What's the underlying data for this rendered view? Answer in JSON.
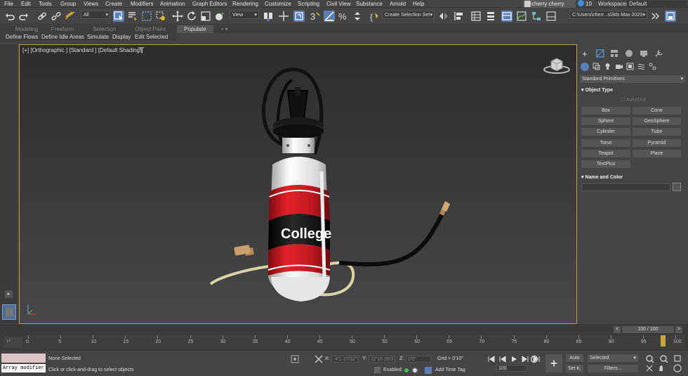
{
  "menu": [
    "File",
    "Edit",
    "Tools",
    "Group",
    "Views",
    "Create",
    "Modifiers",
    "Animation",
    "Graph Editors",
    "Rendering",
    "Customize",
    "Scripting",
    "Civil View",
    "Substance",
    "Arnold",
    "Help"
  ],
  "user": {
    "name": "cherry cherry"
  },
  "notifications": {
    "count": "10"
  },
  "workspaces": {
    "label": "Workspaces:",
    "value": "Default"
  },
  "toolbar": {
    "filter": "All",
    "ref_coord": "View",
    "selection_set": "Create Selection Set",
    "project_path": "C:\\Users\\cherr...s\\3ds Max 2023"
  },
  "ribbon": {
    "tabs": [
      "Modeling",
      "Freeform",
      "Selection",
      "Object Paint",
      "Populate"
    ],
    "active": "Populate",
    "sub_items": [
      "Define Flows",
      "Define Idle Areas",
      "Simulate",
      "Display",
      "Edit Selected"
    ]
  },
  "viewport": {
    "label": "[+] [Orthographic ] [Standard ] [Default Shading ]",
    "product_text": "College"
  },
  "command_panel": {
    "category": "Standard Primitives",
    "object_type_title": "Object Type",
    "autogrid": "AutoGrid",
    "buttons": [
      "Box",
      "Cone",
      "Sphere",
      "GeoSphere",
      "Cylinder",
      "Tube",
      "Torus",
      "Pyramid",
      "Teapot",
      "Plane",
      "TextPlus"
    ],
    "name_color_title": "Name and Color"
  },
  "timeline": {
    "frame_display": "100 / 100",
    "ticks": [
      "0",
      "5",
      "10",
      "15",
      "20",
      "25",
      "30",
      "35",
      "40",
      "45",
      "50",
      "55",
      "60",
      "65",
      "70",
      "75",
      "80",
      "85",
      "90",
      "95",
      "100"
    ]
  },
  "status": {
    "maxscript": "Array modifier",
    "selected": "None Selected",
    "prompt": "Click or click-and-drag to select objects",
    "x_label": "X:",
    "x_val": "-4'1 27/32\"",
    "y_label": "Y:",
    "y_val": "22'10 26/3",
    "z_label": "Z:",
    "z_val": "0'0\"",
    "grid": "Grid = 0'10\"",
    "enabled": "Enabled:",
    "add_time_tag": "Add Time Tag",
    "auto": "Auto",
    "set_key": "Set K.",
    "key_filter": "Selected",
    "filters": "Filters...",
    "frame": "100"
  },
  "colors": {
    "accent": "#5b7fb5",
    "viewport_border": "#b8a34a",
    "jar_red": "#c8161c",
    "jar_black": "#111111"
  }
}
